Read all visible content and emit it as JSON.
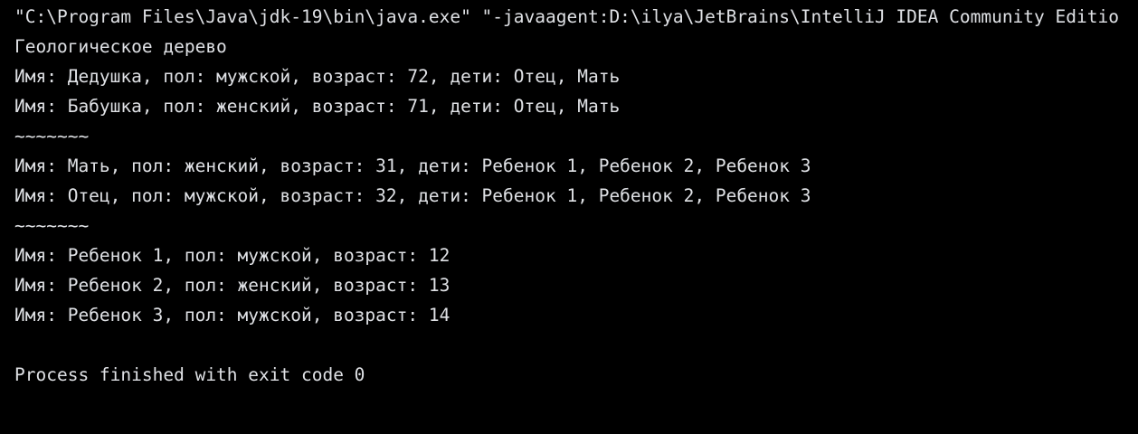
{
  "console": {
    "command_line": "\"C:\\Program Files\\Java\\jdk-19\\bin\\java.exe\" \"-javaagent:D:\\ilya\\JetBrains\\IntelliJ IDEA Community Editio",
    "output_lines": [
      "Геологическое дерево",
      "Имя: Дедушка, пол: мужской, возраст: 72, дети: Отец, Мать",
      "Имя: Бабушка, пол: женский, возраст: 71, дети: Отец, Мать",
      "~~~~~~~",
      "Имя: Мать, пол: женский, возраст: 31, дети: Ребенок 1, Ребенок 2, Ребенок 3",
      "Имя: Отец, пол: мужской, возраст: 32, дети: Ребенок 1, Ребенок 2, Ребенок 3",
      "~~~~~~~",
      "Имя: Ребенок 1, пол: мужской, возраст: 12",
      "Имя: Ребенок 2, пол: женский, возраст: 13",
      "Имя: Ребенок 3, пол: мужской, возраст: 14",
      "",
      "Process finished with exit code 0"
    ]
  }
}
